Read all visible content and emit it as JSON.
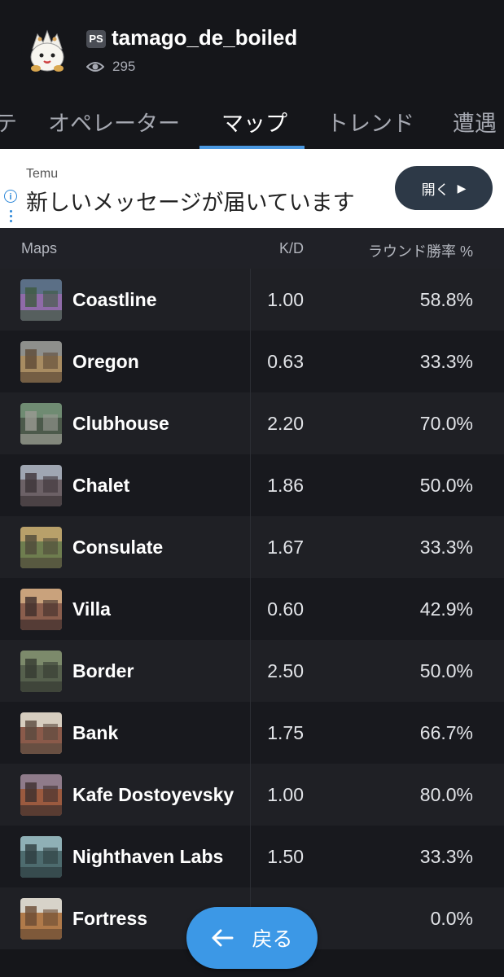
{
  "header": {
    "platform_badge": "PS",
    "username": "tamago_de_boiled",
    "views": "295"
  },
  "tabs": [
    {
      "label": "テ"
    },
    {
      "label": "オペレーター"
    },
    {
      "label": "マップ",
      "active": true
    },
    {
      "label": "トレンド"
    },
    {
      "label": "遭遇"
    }
  ],
  "ad": {
    "brand": "Temu",
    "text": "新しいメッセージが届いています",
    "button_label": "開く"
  },
  "table": {
    "columns": {
      "maps": "Maps",
      "kd": "K/D",
      "win": "ラウンド勝率 %"
    },
    "rows": [
      {
        "map": "Coastline",
        "kd": "1.00",
        "win": "58.8%",
        "thumb_colors": [
          "#5b6f86",
          "#8f6ba8",
          "#3d5a3f"
        ]
      },
      {
        "map": "Oregon",
        "kd": "0.63",
        "win": "33.3%",
        "thumb_colors": [
          "#8e8f8c",
          "#a88c62",
          "#5e4a37"
        ]
      },
      {
        "map": "Clubhouse",
        "kd": "2.20",
        "win": "70.0%",
        "thumb_colors": [
          "#6f8b72",
          "#4c5a4b",
          "#9a9a92"
        ]
      },
      {
        "map": "Chalet",
        "kd": "1.86",
        "win": "50.0%",
        "thumb_colors": [
          "#9fa6b2",
          "#6c6166",
          "#3d3438"
        ]
      },
      {
        "map": "Consulate",
        "kd": "1.67",
        "win": "33.3%",
        "thumb_colors": [
          "#b8a06a",
          "#6e7d4f",
          "#4f4a3a"
        ]
      },
      {
        "map": "Villa",
        "kd": "0.60",
        "win": "42.9%",
        "thumb_colors": [
          "#c9a27c",
          "#8a5e4d",
          "#3f2e2c"
        ]
      },
      {
        "map": "Border",
        "kd": "2.50",
        "win": "50.0%",
        "thumb_colors": [
          "#7c8a6b",
          "#56604d",
          "#363b32"
        ]
      },
      {
        "map": "Bank",
        "kd": "1.75",
        "win": "66.7%",
        "thumb_colors": [
          "#d6cdbf",
          "#8a5a4a",
          "#5a4a3f"
        ]
      },
      {
        "map": "Kafe Dostoyevsky",
        "kd": "1.00",
        "win": "80.0%",
        "thumb_colors": [
          "#8f7b8a",
          "#9b5a3f",
          "#3d2f2e"
        ]
      },
      {
        "map": "Nighthaven Labs",
        "kd": "1.50",
        "win": "33.3%",
        "thumb_colors": [
          "#8fb0b6",
          "#4d6b6e",
          "#2e3d40"
        ]
      },
      {
        "map": "Fortress",
        "kd": "",
        "win": "0.0%",
        "thumb_colors": [
          "#d7d3c9",
          "#b07a4a",
          "#6a4b33"
        ]
      }
    ]
  },
  "back_button": {
    "label": "戻る"
  },
  "colors": {
    "background": "#15161a",
    "row_odd": "#1f2025",
    "row_even": "#18191e",
    "accent": "#4a98e0",
    "back_button": "#3c98e6",
    "ad_button": "#2d3947"
  }
}
